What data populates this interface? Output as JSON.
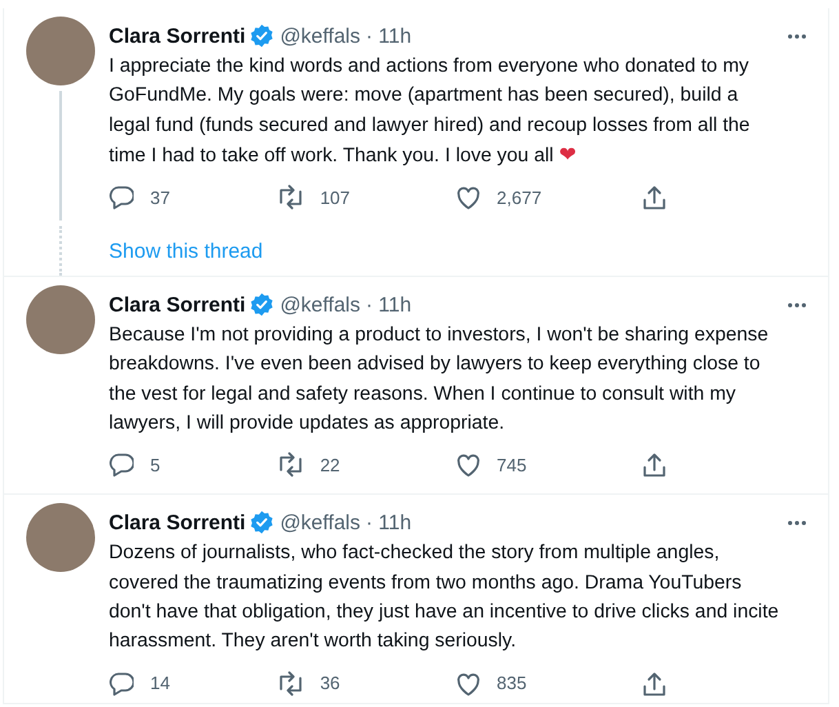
{
  "tweets": [
    {
      "name": "Clara Sorrenti",
      "verified": true,
      "handle": "@keffals",
      "time": "· 11h",
      "text": "I appreciate the kind words and actions from everyone who donated to my GoFundMe. My goals were: move (apartment has been secured), build a legal fund (funds secured and lawyer hired) and recoup losses from all the time I had to take off work. Thank you. I love you all",
      "emoji": "❤",
      "replies": "37",
      "retweets": "107",
      "likes": "2,677",
      "thread_link": "Show this thread"
    },
    {
      "name": "Clara Sorrenti",
      "verified": true,
      "handle": "@keffals",
      "time": "· 11h",
      "text": "Because I'm not providing a product to investors, I won't be sharing expense breakdowns. I've even been advised by lawyers to keep everything close to the vest for legal and safety reasons. When I continue to consult with my lawyers, I will provide updates as appropriate.",
      "replies": "5",
      "retweets": "22",
      "likes": "745"
    },
    {
      "name": "Clara Sorrenti",
      "verified": true,
      "handle": "@keffals",
      "time": "· 11h",
      "text": "Dozens of journalists, who fact-checked the story from multiple angles, covered the traumatizing events from two months ago. Drama YouTubers don't have that obligation, they just have an incentive to drive clicks and incite harassment. They aren't worth taking seriously.",
      "replies": "14",
      "retweets": "36",
      "likes": "835"
    }
  ]
}
